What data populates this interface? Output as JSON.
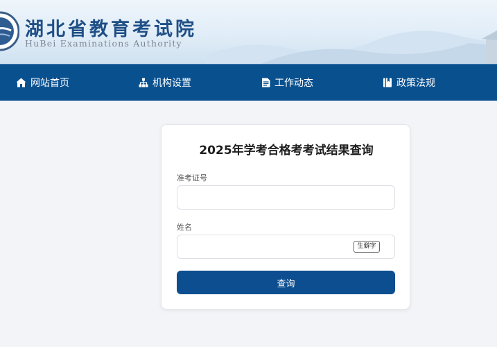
{
  "header": {
    "title_cn": "湖北省教育考试院",
    "title_en": "HuBei Examinations Authority",
    "logo_icon": "emblem-logo-icon"
  },
  "nav": {
    "items": [
      {
        "label": "网站首页",
        "icon": "home-icon"
      },
      {
        "label": "机构设置",
        "icon": "sitemap-icon"
      },
      {
        "label": "工作动态",
        "icon": "news-icon"
      },
      {
        "label": "政策法规",
        "icon": "book-icon"
      }
    ]
  },
  "form": {
    "title": "2025年学考合格考考试结果查询",
    "exam_id_label": "准考证号",
    "exam_id_value": "",
    "name_label": "姓名",
    "name_value": "",
    "rare_char_button": "生僻字",
    "submit_label": "查询"
  },
  "colors": {
    "nav_bg": "#09508f",
    "button_bg": "#0c4e8f",
    "page_bg": "#f2f4f7"
  }
}
